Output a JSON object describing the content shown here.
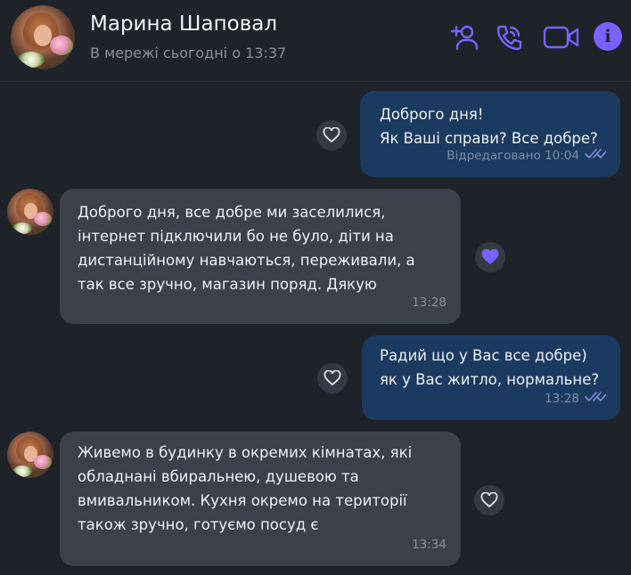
{
  "header": {
    "name": "Марина Шаповал",
    "status": "В мережі сьогодні о 13:37",
    "icons": [
      "add-contact-icon",
      "call-icon",
      "video-call-icon",
      "info-icon"
    ],
    "info_glyph": "i",
    "accent": "#7b61ff"
  },
  "messages": [
    {
      "direction": "out",
      "text": "Доброго дня!\nЯк Ваші справи? Все добре?",
      "meta": "Відредаговано 10:04",
      "read": true,
      "reaction": "heart-outline-icon"
    },
    {
      "direction": "in",
      "text": "Доброго дня, все добре ми заселилися,\nінтернет підключили бо не було, діти на\nдистанційному навчаються, переживали, а\nтак все зручно, магазин поряд. Дякую",
      "meta": "13:28",
      "reaction": "heart-filled-icon"
    },
    {
      "direction": "out",
      "text": "Радий що у Вас все добре)\nяк у Вас житло, нормальне?",
      "meta": "13:28",
      "read": true,
      "reaction": "heart-outline-icon"
    },
    {
      "direction": "in",
      "text": "Живемо в будинку в окремих кімнатах, які\nобладнані вбиральнею, душевою та\nвмивальником. Кухня окремо на території\nтакож зручно, готуємо посуд є",
      "meta": "13:34",
      "reaction": "heart-outline-icon"
    }
  ],
  "colors": {
    "background": "#1e2229",
    "bubble_out": "#1b3a5f",
    "bubble_in": "#3a414b",
    "accent": "#7b61ff"
  }
}
